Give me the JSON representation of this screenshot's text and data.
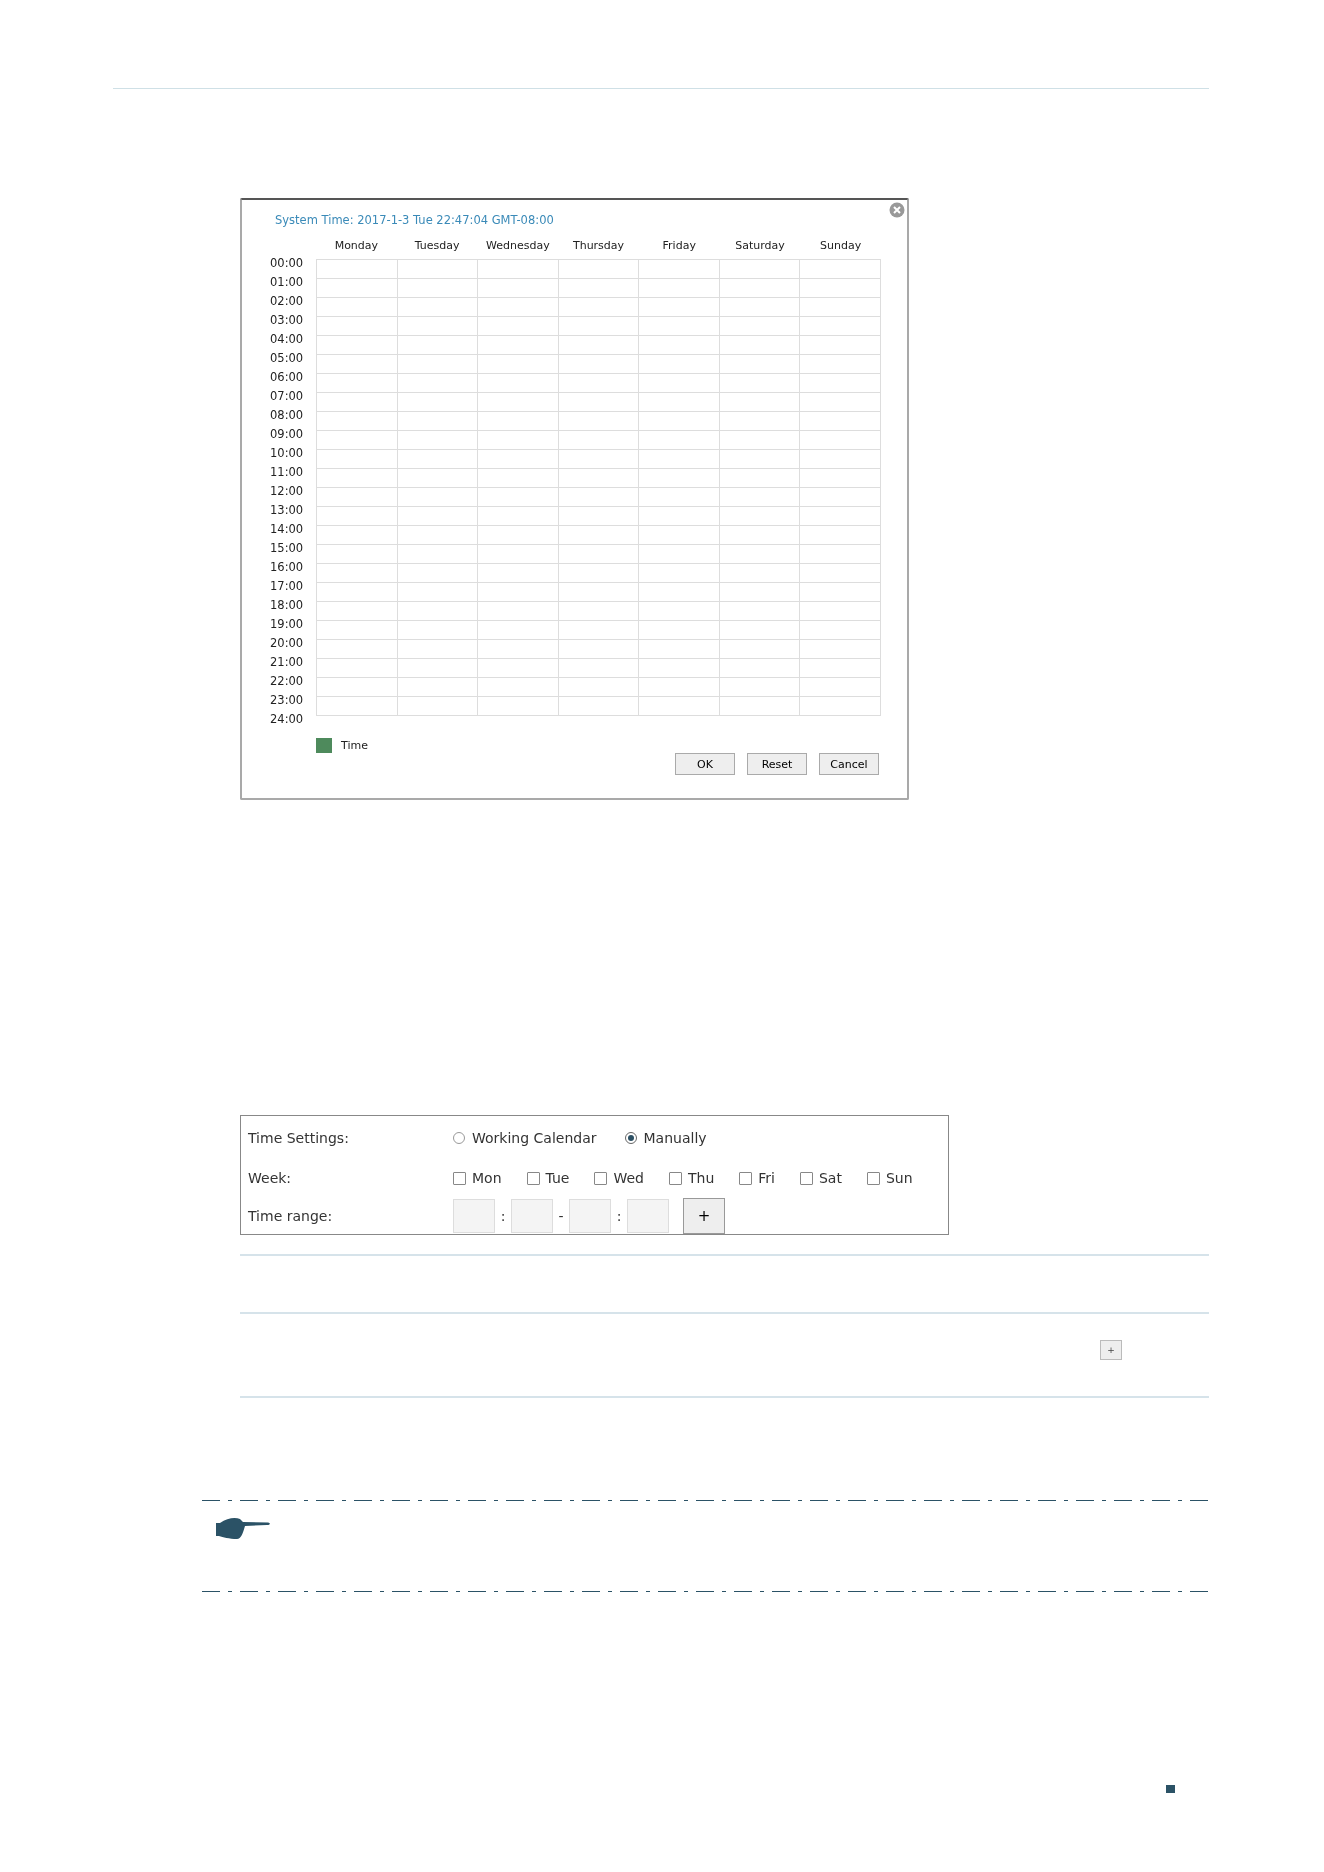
{
  "schedule_dialog": {
    "system_time": "System Time: 2017-1-3 Tue 22:47:04 GMT-08:00",
    "days": [
      "Monday",
      "Tuesday",
      "Wednesday",
      "Thursday",
      "Friday",
      "Saturday",
      "Sunday"
    ],
    "times": [
      "00:00",
      "01:00",
      "02:00",
      "03:00",
      "04:00",
      "05:00",
      "06:00",
      "07:00",
      "08:00",
      "09:00",
      "10:00",
      "11:00",
      "12:00",
      "13:00",
      "14:00",
      "15:00",
      "16:00",
      "17:00",
      "18:00",
      "19:00",
      "20:00",
      "21:00",
      "22:00",
      "23:00",
      "24:00"
    ],
    "legend": {
      "label": "Time",
      "color": "#4e8a5c"
    },
    "buttons": [
      "OK",
      "Reset",
      "Cancel"
    ]
  },
  "time_form": {
    "time_settings_label": "Time Settings:",
    "modes": [
      {
        "label": "Working Calendar",
        "selected": false
      },
      {
        "label": "Manually",
        "selected": true
      }
    ],
    "week_label": "Week:",
    "week_days": [
      {
        "label": "Mon",
        "checked": false
      },
      {
        "label": "Tue",
        "checked": false
      },
      {
        "label": "Wed",
        "checked": false
      },
      {
        "label": "Thu",
        "checked": false
      },
      {
        "label": "Fri",
        "checked": false
      },
      {
        "label": "Sat",
        "checked": false
      },
      {
        "label": "Sun",
        "checked": false
      }
    ],
    "time_range_label": "Time range:",
    "time_range_separators": [
      ":",
      "-",
      ":"
    ],
    "add_button": "+"
  },
  "table": {
    "add_button": "+"
  }
}
